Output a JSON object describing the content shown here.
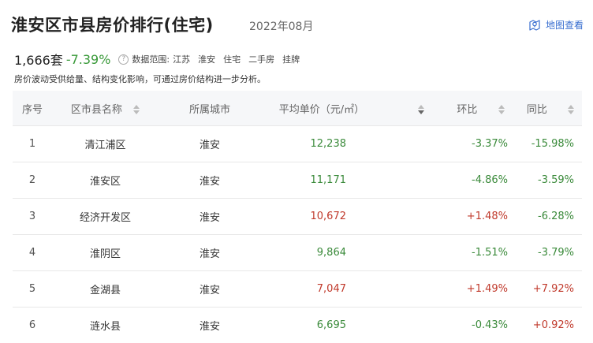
{
  "header": {
    "title": "淮安区市县房价排行(住宅)",
    "date": "2022年08月",
    "map_link": "地图查看"
  },
  "summary": {
    "count": "1,666套",
    "change": "-7.39%",
    "scope_label": "数据范围:",
    "scope_tags": [
      "江苏",
      "淮安",
      "住宅",
      "二手房",
      "挂牌"
    ]
  },
  "note": "房价波动受供给量、结构变化影响，可通过房价结构进一步分析。",
  "table": {
    "columns": [
      "序号",
      "区市县名称",
      "所属城市",
      "平均单价（元/㎡）",
      "环比",
      "同比"
    ],
    "rows": [
      {
        "index": "1",
        "name": "清江浦区",
        "city": "淮安",
        "price": "12,238",
        "price_trend": "down",
        "mom": "-3.37%",
        "mom_trend": "down",
        "yoy": "-15.98%",
        "yoy_trend": "down"
      },
      {
        "index": "2",
        "name": "淮安区",
        "city": "淮安",
        "price": "11,171",
        "price_trend": "down",
        "mom": "-4.86%",
        "mom_trend": "down",
        "yoy": "-3.59%",
        "yoy_trend": "down"
      },
      {
        "index": "3",
        "name": "经济开发区",
        "city": "淮安",
        "price": "10,672",
        "price_trend": "up",
        "mom": "+1.48%",
        "mom_trend": "up",
        "yoy": "-6.28%",
        "yoy_trend": "down"
      },
      {
        "index": "4",
        "name": "淮阴区",
        "city": "淮安",
        "price": "9,864",
        "price_trend": "down",
        "mom": "-1.51%",
        "mom_trend": "down",
        "yoy": "-3.79%",
        "yoy_trend": "down"
      },
      {
        "index": "5",
        "name": "金湖县",
        "city": "淮安",
        "price": "7,047",
        "price_trend": "up",
        "mom": "+1.49%",
        "mom_trend": "up",
        "yoy": "+7.92%",
        "yoy_trend": "up"
      },
      {
        "index": "6",
        "name": "涟水县",
        "city": "淮安",
        "price": "6,695",
        "price_trend": "down",
        "mom": "-0.43%",
        "mom_trend": "down",
        "yoy": "+0.92%",
        "yoy_trend": "up"
      }
    ]
  },
  "colors": {
    "up": "#c0392b",
    "down": "#3a8a3a",
    "accent": "#3a6fd0"
  }
}
